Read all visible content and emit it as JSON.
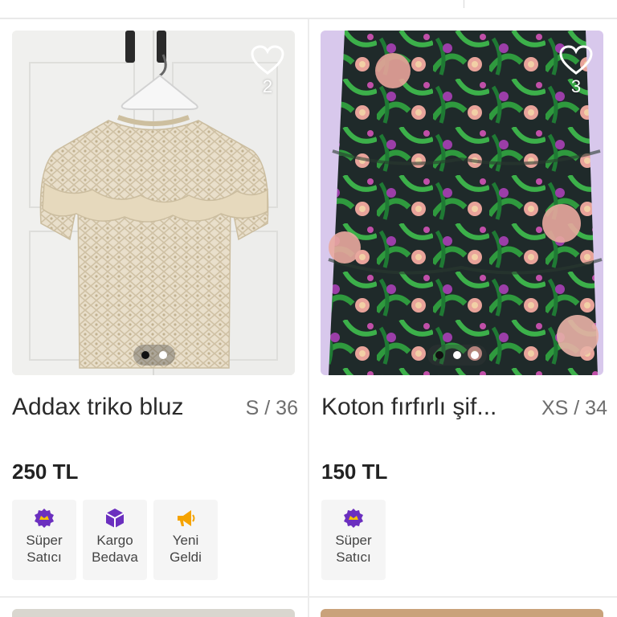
{
  "products": [
    {
      "title": "Addax triko bluz",
      "size": "S / 36",
      "price": "250 TL",
      "likes": "2",
      "carousel": {
        "total": 2,
        "active": 1
      },
      "badges": [
        {
          "icon": "super-seller-icon",
          "label_line1": "Süper",
          "label_line2": "Satıcı",
          "color": "#6b2fbf"
        },
        {
          "icon": "free-shipping-box-icon",
          "label_line1": "Kargo",
          "label_line2": "Bedava",
          "color": "#6b2fbf"
        },
        {
          "icon": "megaphone-icon",
          "label_line1": "Yeni",
          "label_line2": "Geldi",
          "color": "#f5a300"
        }
      ]
    },
    {
      "title": "Koton fırfırlı şif...",
      "size": "XS / 34",
      "price": "150 TL",
      "likes": "3",
      "carousel": {
        "total": 3,
        "active": 1
      },
      "badges": [
        {
          "icon": "super-seller-icon",
          "label_line1": "Süper",
          "label_line2": "Satıcı",
          "color": "#6b2fbf"
        }
      ]
    }
  ],
  "colors": {
    "accent_purple": "#6b2fbf",
    "accent_orange": "#f5a300",
    "text_dark": "#2b2b2b",
    "text_muted": "#6e6e6e"
  }
}
